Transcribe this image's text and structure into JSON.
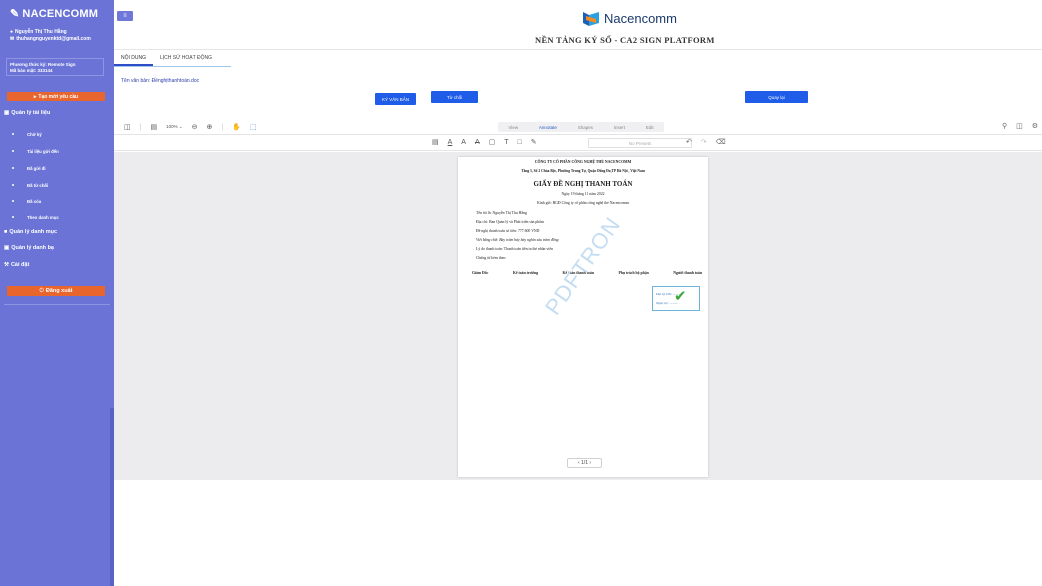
{
  "sidebar": {
    "logo": "NACENCOMM",
    "user_name": "Nguyễn Thị Thu Hằng",
    "user_email": "thuhangnguyenktd@gmail.com",
    "verify_method": "Phương thức ký: Remote Sign",
    "serial": "Mã bảo mật: 333144",
    "request_button": "Tạo mới yêu cầu",
    "sections": {
      "doc_mgmt": "Quản lý tài liệu",
      "category_mgmt": "Quản lý danh mục",
      "contacts_mgmt": "Quản lý danh bạ",
      "settings": "Cài đặt"
    },
    "doc_items": [
      "Chờ ký",
      "Tài liệu gửi đến",
      "Đã gửi đi",
      "Đã từ chối",
      "Đã xóa",
      "Theo danh mục"
    ],
    "logout_button": "Đăng xuất",
    "color": "#6b74d6"
  },
  "header": {
    "menu_icon": "≡",
    "brand": "Nacencomm",
    "platform": "NỀN TẢNG KÝ SỐ - CA2 SIGN PLATFORM"
  },
  "tabs": [
    "NỘI DUNG",
    "LỊCH SỬ HOẠT ĐỘNG"
  ],
  "document": {
    "name_label": "Tên văn bản: Đềnghịthanhtoán.doc"
  },
  "actions": {
    "sign": "KÝ VĂN BẢN",
    "reject": "Từ chối",
    "back": "Quay lại"
  },
  "viewer": {
    "zoom": "100%",
    "modes": [
      "View",
      "Annotate",
      "Shapes",
      "Insert",
      "Edit"
    ],
    "active_mode": "Annotate",
    "presets": "No Presets",
    "pager": "‹ 1/1 ›"
  },
  "page": {
    "company": "CÔNG TY CỔ PHẦN CÔNG NGHỆ THẺ NACENCOMM",
    "address": "Tầng 5, Số 2 Chùa Bộc, Phường Trung Tự, Quận Đống Đa,TP Hà Nội , Việt Nam",
    "title": "GIẤY ĐỀ NGHỊ THANH TOÁN",
    "date": "Ngày   19  tháng 11   năm 2022",
    "to": "Kính gửi:  BGĐ Công ty cổ phần công nghệ thẻ Nacencomm",
    "lines": [
      "Tên tôi là: Nguyễn Thị Thu Hằng",
      "Địa chỉ: Ban Quản lý và Phát triển sản phẩm",
      "Đề nghị thanh toán số tiền:   777.600       VND",
      "Viết bằng chữ: Bảy trăm bảy bảy nghìn sáu trăm đồng",
      "Lý do thanh toán: Thanh toán tiền in thẻ nhân viên",
      "Chứng từ kèm theo:"
    ],
    "signers": [
      "Giám Đốc",
      "Kế toán trưởng",
      "Kế toán thanh toán",
      "Phụ trách bộ phận",
      "Người thanh toán"
    ],
    "sig_line1": "Đạt ký bởi: ..........",
    "sig_line2": "Ngày ký: ..........",
    "watermark": "PDFTRON"
  }
}
